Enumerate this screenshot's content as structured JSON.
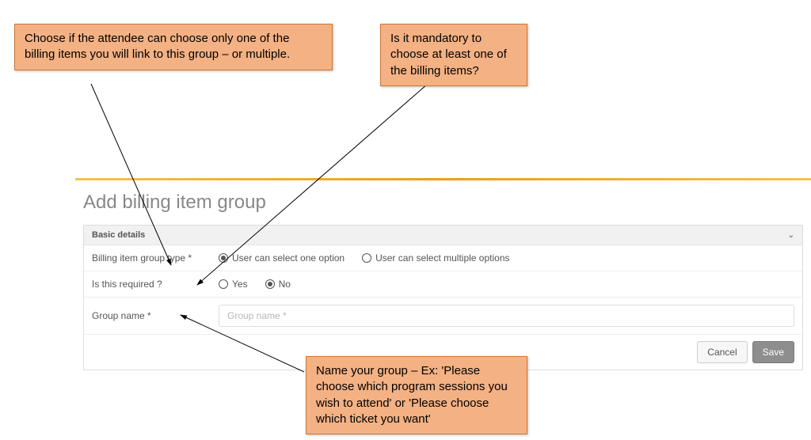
{
  "callouts": {
    "type": "Choose if the attendee can choose only one of the billing items you will link to this group – or multiple.",
    "required": "Is it mandatory to choose at least one of the billing items?",
    "name": "Name your group – Ex: 'Please choose which program sessions you wish to attend' or 'Please choose which ticket you want'"
  },
  "page": {
    "title": "Add billing item group",
    "panel_heading": "Basic details",
    "labels": {
      "group_type": "Billing item group type *",
      "required": "Is this required ?",
      "group_name": "Group name *"
    },
    "options": {
      "type_one": "User can select one option",
      "type_many": "User can select multiple options",
      "yes": "Yes",
      "no": "No"
    },
    "group_name_value": "",
    "group_name_placeholder": "Group name *",
    "selected": {
      "group_type": "one",
      "required": "no"
    },
    "buttons": {
      "cancel": "Cancel",
      "save": "Save"
    }
  }
}
